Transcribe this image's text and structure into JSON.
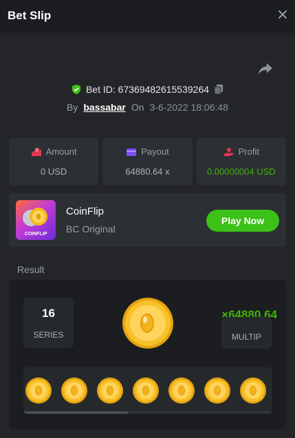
{
  "header": {
    "title": "Bet Slip"
  },
  "bet": {
    "id_text": "Bet ID: 673694826155392​64",
    "by_label": "By",
    "username": "bassabar",
    "on_label": "On",
    "datetime": "3-6-2022 18:06:48"
  },
  "stats": {
    "amount": {
      "label": "Amount",
      "value": "0 USD"
    },
    "payout": {
      "label": "Payout",
      "value": "64880.64 x"
    },
    "profit": {
      "label": "Profit",
      "value": "0.00000004 USD"
    }
  },
  "game": {
    "name": "CoinFlip",
    "subtitle": "BC Original",
    "thumb_text": "COINFLIP",
    "play_label": "Play Now"
  },
  "result": {
    "label": "Result",
    "series_value": "16",
    "series_label": "SERIES",
    "multiplier_value": "×64880.64",
    "multiplier_label": "MULTIP"
  },
  "colors": {
    "accent_green": "#3bc117",
    "profit_green": "#43b309",
    "coin_gold": "#f5b81c"
  },
  "icons": {
    "close": "close-icon",
    "share": "share-icon",
    "verified": "shield-check-icon",
    "copy": "copy-icon",
    "amount": "coins-icon",
    "payout": "wallet-icon",
    "profit": "profit-hand-icon",
    "coin": "coin-icon"
  }
}
